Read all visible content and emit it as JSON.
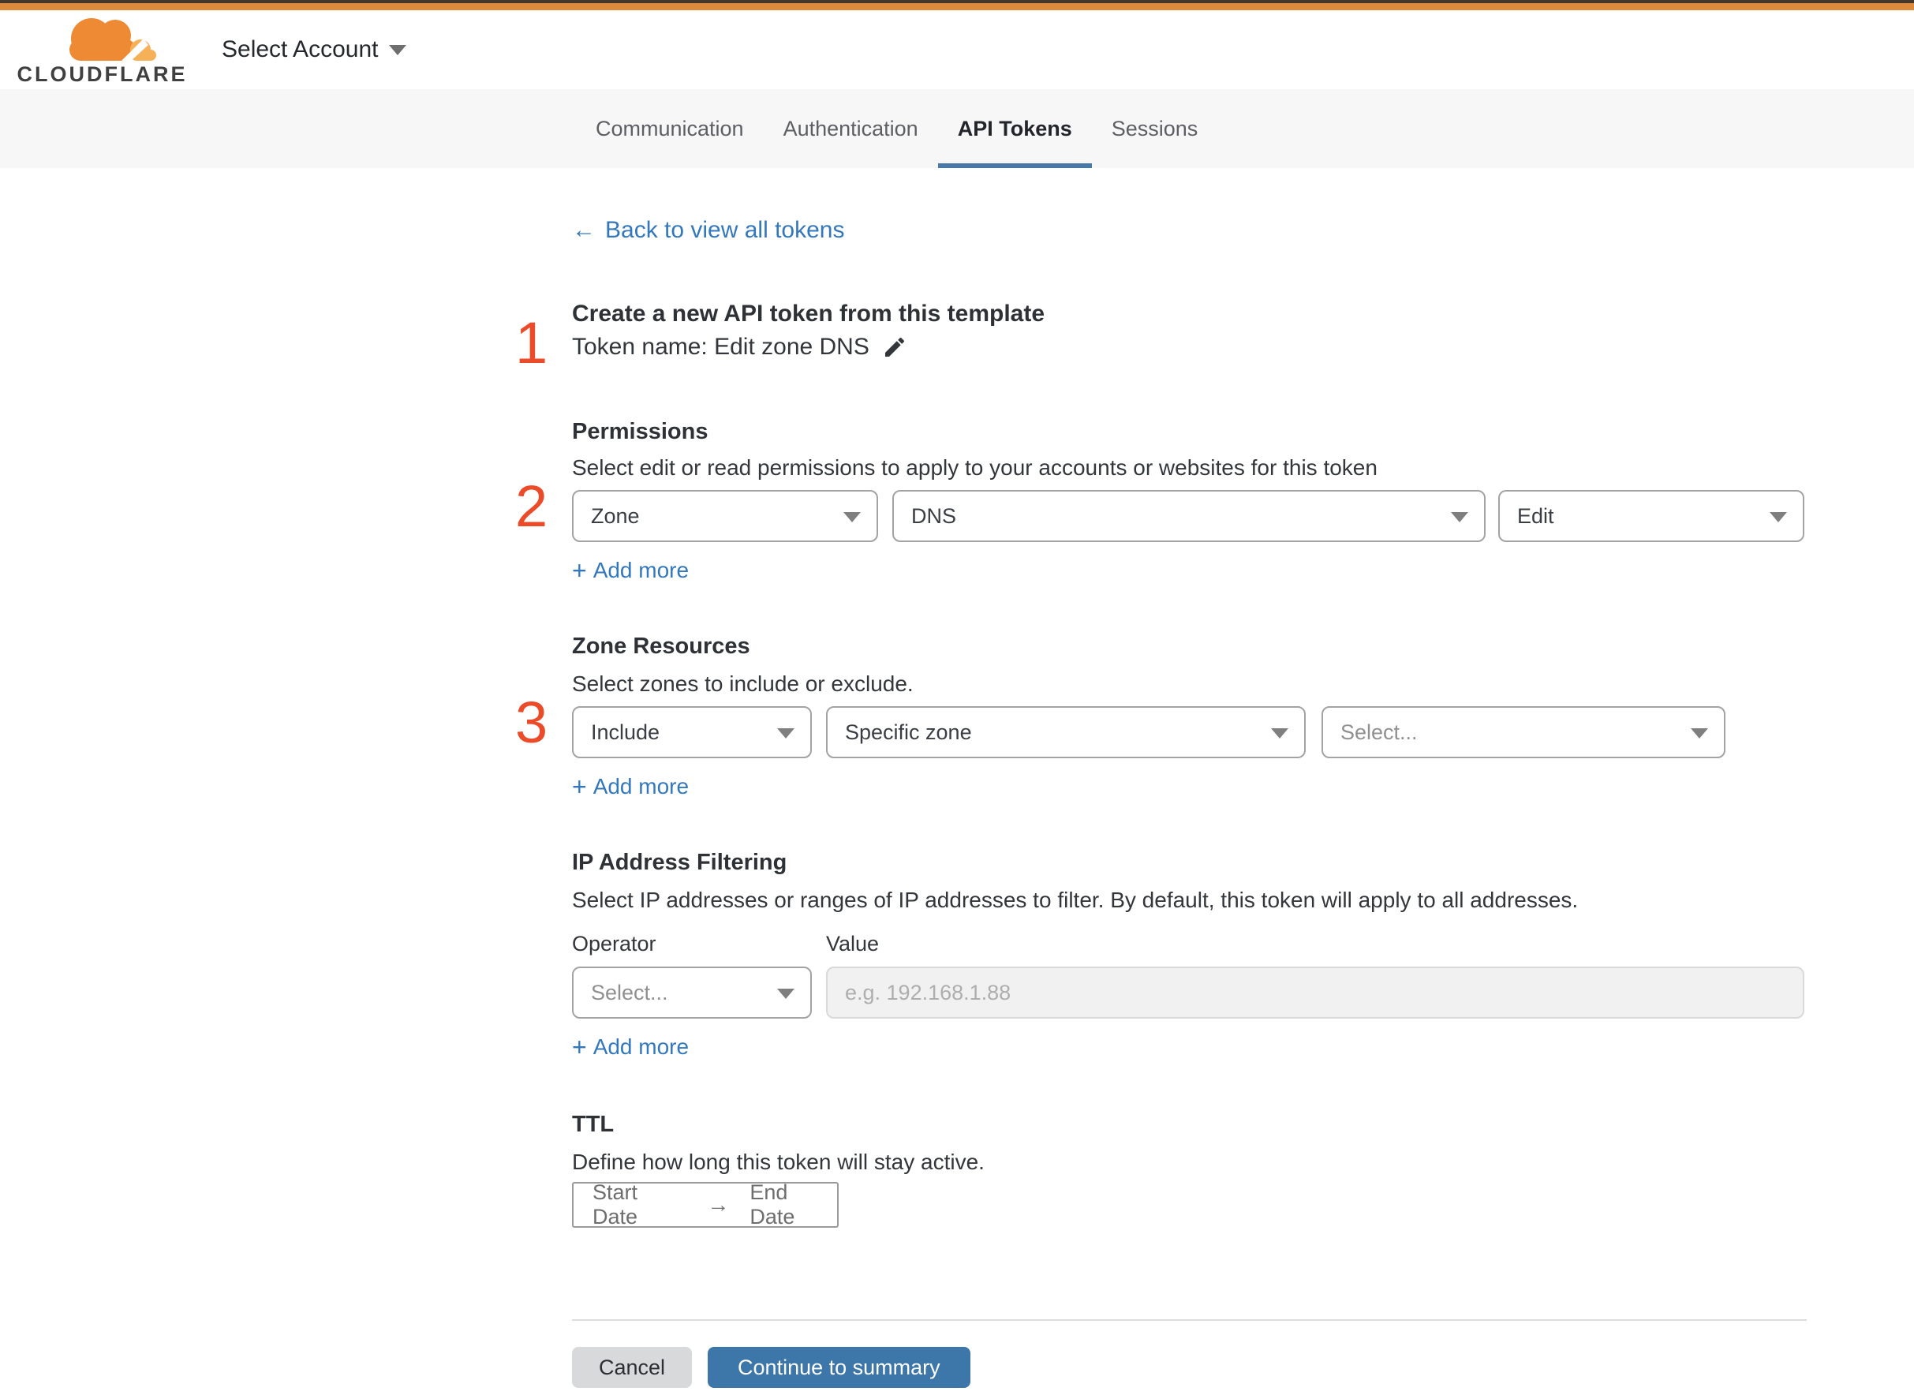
{
  "brand": {
    "wordmark": "CLOUDFLARE",
    "account_selector_label": "Select Account"
  },
  "tabs": {
    "items": [
      {
        "label": "Communication",
        "active": false
      },
      {
        "label": "Authentication",
        "active": false
      },
      {
        "label": "API Tokens",
        "active": true
      },
      {
        "label": "Sessions",
        "active": false
      }
    ]
  },
  "back_link": {
    "arrow": "←",
    "label": "Back to view all tokens"
  },
  "token_section": {
    "step": "1",
    "heading": "Create a new API token from this template",
    "token_line": "Token name: Edit zone DNS"
  },
  "permissions": {
    "step": "2",
    "heading": "Permissions",
    "description": "Select edit or read permissions to apply to your accounts or websites for this token",
    "selects": [
      {
        "value": "Zone"
      },
      {
        "value": "DNS"
      },
      {
        "value": "Edit"
      }
    ]
  },
  "zone_resources": {
    "step": "3",
    "heading": "Zone Resources",
    "description": "Select zones to include or exclude.",
    "selects": [
      {
        "value": "Include"
      },
      {
        "value": "Specific zone"
      },
      {
        "value": "Select..."
      }
    ]
  },
  "ip_filtering": {
    "heading": "IP Address Filtering",
    "description": "Select IP addresses or ranges of IP addresses to filter. By default, this token will apply to all addresses.",
    "operator_label": "Operator",
    "value_label": "Value",
    "operator_select_value": "Select...",
    "value_placeholder": "e.g. 192.168.1.88"
  },
  "ttl": {
    "heading": "TTL",
    "description": "Define how long this token will stay active.",
    "start_label": "Start Date",
    "arrow": "→",
    "end_label": "End Date"
  },
  "add_more": {
    "plus": "+",
    "label": "Add more"
  },
  "footer": {
    "cancel_label": "Cancel",
    "continue_label": "Continue to summary"
  },
  "colors": {
    "topbar_orange": "#DD8A3D",
    "tab_underline_blue": "#4879A9",
    "link_blue": "#3378BD",
    "continue_button_blue": "#3D76A8",
    "step_number_red": "#EB4B28"
  }
}
